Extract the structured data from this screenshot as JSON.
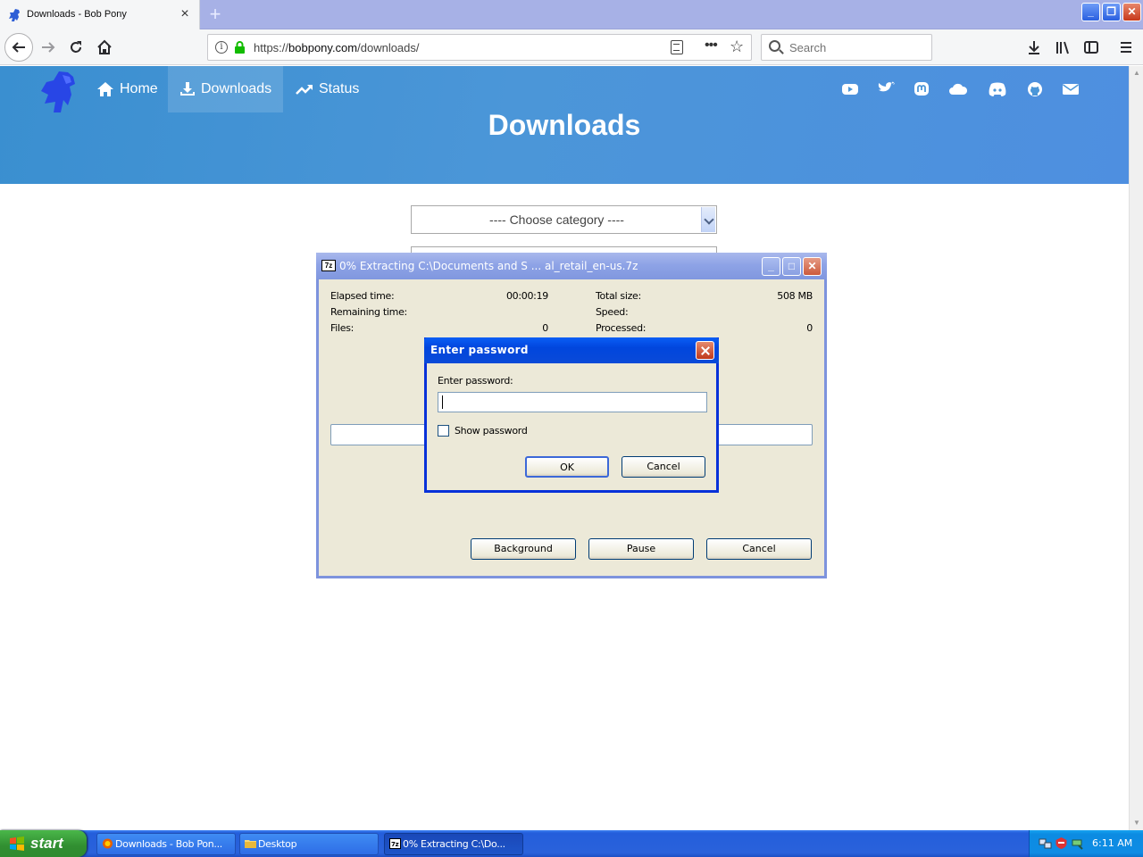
{
  "browser": {
    "tab_title": "Downloads - Bob Pony",
    "tab_close": "×",
    "new_tab": "+",
    "url_scheme": "https://",
    "url_host": "bobpony.com",
    "url_path": "/downloads/",
    "search_placeholder": "Search"
  },
  "site": {
    "nav": [
      {
        "label": "Home"
      },
      {
        "label": "Downloads"
      },
      {
        "label": "Status"
      }
    ],
    "hero_title": "Downloads",
    "category_placeholder": "---- Choose category ----",
    "brand_color": "#4b96d8"
  },
  "zip": {
    "title": "0% Extracting C:\\Documents and S ... al_retail_en-us.7z",
    "icon_text": "7z",
    "elapsed_label": "Elapsed time:",
    "elapsed_value": "00:00:19",
    "remaining_label": "Remaining time:",
    "remaining_value": "",
    "files_label": "Files:",
    "files_value": "0",
    "total_size_label": "Total size:",
    "total_size_value": "508 MB",
    "speed_label": "Speed:",
    "speed_value": "",
    "processed_label": "Processed:",
    "processed_value": "0",
    "progress": 0,
    "background_label": "Background",
    "pause_label": "Pause",
    "cancel_label": "Cancel"
  },
  "password_dialog": {
    "title": "Enter password",
    "prompt": "Enter password:",
    "value": "",
    "show_password_label": "Show password",
    "show_password_checked": false,
    "ok_label": "OK",
    "cancel_label": "Cancel"
  },
  "taskbar": {
    "start_label": "start",
    "tasks": [
      {
        "label": "Downloads - Bob Pon...",
        "icon": "firefox-icon"
      },
      {
        "label": "Desktop",
        "icon": "folder-icon"
      },
      {
        "label": "0% Extracting C:\\Do...",
        "icon": "7zip-icon"
      }
    ],
    "clock": "6:11 AM"
  }
}
